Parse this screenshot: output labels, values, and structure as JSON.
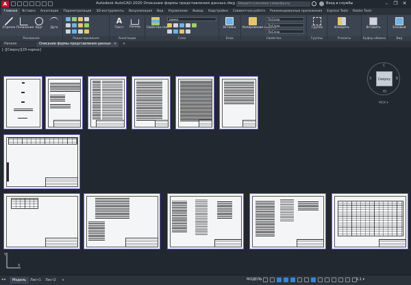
{
  "app": {
    "logo": "A",
    "title": "Autodesk AutoCAD 2020   Описание формы представления данных.dwg",
    "search_placeholder": "Введите ключевое слово/фразу",
    "signin": "Вход в службы",
    "window_buttons": [
      "–",
      "❐",
      "✕"
    ]
  },
  "ribbon_tabs": [
    "Главная",
    "Вставка",
    "Аннотации",
    "Параметризация",
    "3D-инструменты",
    "Визуализация",
    "Вид",
    "Управление",
    "Вывод",
    "Надстройки",
    "Совместная работа",
    "Рекомендованные приложения",
    "Express Tools",
    "Raster Tools"
  ],
  "ribbon": {
    "groups": [
      "Рисование",
      "Редактирование",
      "Аннотации",
      "Слои",
      "Блок",
      "Свойства",
      "Группы",
      "Утилиты",
      "Буфер обмена",
      "Вид"
    ],
    "tools": {
      "line": "Отрезок",
      "polyline": "Полилиния",
      "circle": "Круг",
      "arc": "Дуга",
      "text": "Текст",
      "dimension": "Размер",
      "layer_props": "Свойства слоя",
      "insert": "Вставка",
      "match_props": "Копирование свойств",
      "group": "Группа",
      "measure": "Измерить",
      "paste": "Вставить",
      "base": "Базовый"
    },
    "combos": {
      "layer": "рамка",
      "bylayer1": "ПоСлою",
      "bylayer2": "ПоСлою",
      "bylayer3": "ПоСлою"
    }
  },
  "file_tabs": {
    "start": "Начало",
    "doc": "Описание формы представления данных",
    "close": "×",
    "add": "+"
  },
  "viewport": {
    "label": "[–][Сверху][2D-каркас]",
    "viewcube": {
      "face": "Сверху",
      "north": "С",
      "south": "Ю",
      "west": "З",
      "east": "В"
    },
    "wcs": "МСК ▾",
    "ucs_x": "X",
    "ucs_y": "Y"
  },
  "layout_tabs": {
    "arrows": "◂ ▸",
    "model": "Модель",
    "layout1": "Лист1",
    "layout2": "Лист2",
    "add": "+"
  },
  "status": {
    "model": "МОДЕЛЬ",
    "scale": "1:1 ▾"
  },
  "colors": {
    "sheet_border": "#6f64c8",
    "app_red": "#c8102e",
    "background": "#212830"
  }
}
